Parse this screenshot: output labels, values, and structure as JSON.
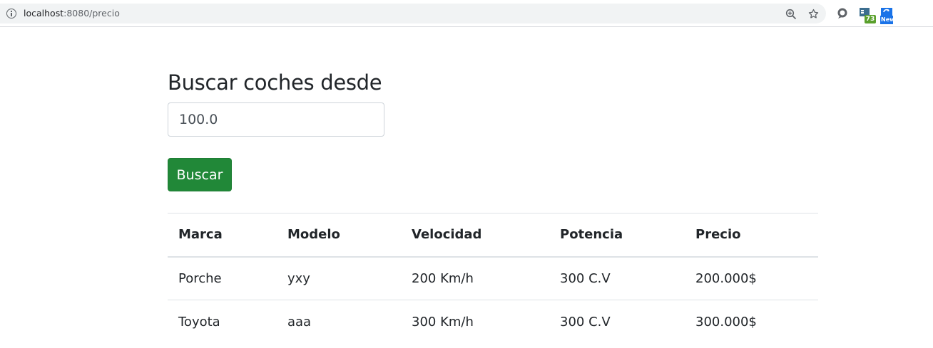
{
  "browser": {
    "url_host": "localhost",
    "url_rest": ":8080/precio",
    "extensions": {
      "badge_count": "73",
      "badge_new": "New"
    }
  },
  "page": {
    "title": "Buscar coches desde",
    "price_input_value": "100.0",
    "search_button_label": "Buscar"
  },
  "table": {
    "headers": [
      "Marca",
      "Modelo",
      "Velocidad",
      "Potencia",
      "Precio"
    ],
    "rows": [
      [
        "Porche",
        "yxy",
        "200 Km/h",
        "300 C.V",
        "200.000$"
      ],
      [
        "Toyota",
        "aaa",
        "300 Km/h",
        "300 C.V",
        "300.000$"
      ]
    ]
  },
  "colors": {
    "button_bg": "#218838",
    "text": "#212529",
    "border": "#dee2e6"
  }
}
